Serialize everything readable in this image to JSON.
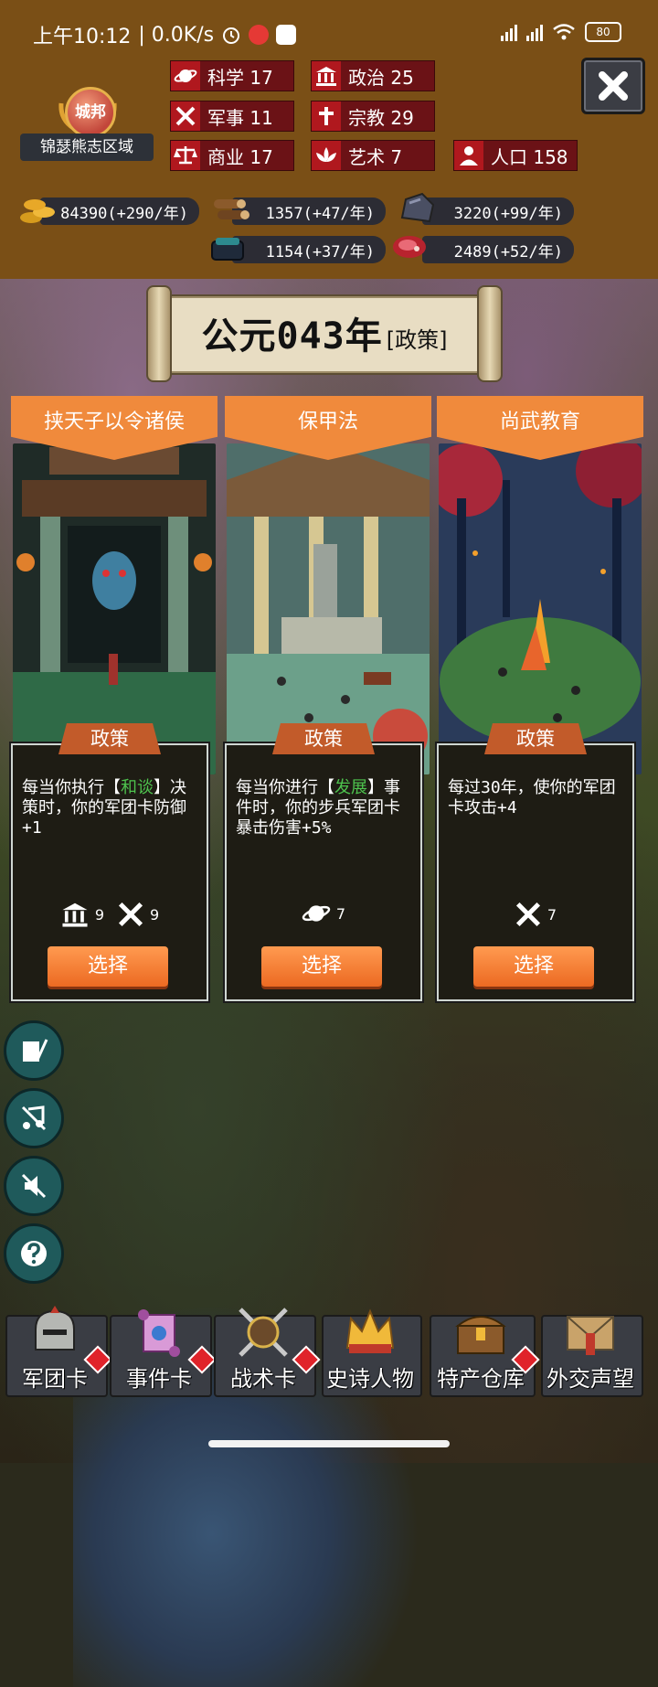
{
  "status_bar": {
    "time": "上午10:12",
    "speed": "| 0.0K/s",
    "battery": "80"
  },
  "region": {
    "emblem_text": "城邦",
    "name": "锦瑟熊志区域"
  },
  "stats": {
    "science": "科学 17",
    "politics": "政治 25",
    "military": "军事 11",
    "religion": "宗教 29",
    "commerce": "商业 17",
    "art": "艺术 7",
    "population": "人口 158"
  },
  "resources": {
    "gold": "84390(+290/年)",
    "wood": "1357(+47/年)",
    "ore": "3220(+99/年)",
    "cloth": "1154(+37/年)",
    "meat": "2489(+52/年)"
  },
  "title": {
    "main": "公元043年",
    "sub": "[政策]"
  },
  "cards": [
    {
      "name": "挟天子以令诸侯",
      "tag": "政策",
      "desc_a": "每当你执行【",
      "desc_hl": "和谈",
      "desc_b": "】决策时，你的军团卡防御+1",
      "req1": "9",
      "req2": "9",
      "button": "选择"
    },
    {
      "name": "保甲法",
      "tag": "政策",
      "desc_a": "每当你进行【",
      "desc_hl": "发展",
      "desc_b": "】事件时，你的步兵军团卡暴击伤害+5%",
      "req1": "7",
      "button": "选择"
    },
    {
      "name": "尚武教育",
      "tag": "政策",
      "desc_a": "每过30年，使你的军团卡攻击+4",
      "req1": "7",
      "button": "选择"
    }
  ],
  "bottom_nav": [
    {
      "label": "军团卡"
    },
    {
      "label": "事件卡"
    },
    {
      "label": "战术卡"
    },
    {
      "label": "史诗人物"
    },
    {
      "label": "特产仓库"
    },
    {
      "label": "外交声望"
    }
  ],
  "colors": {
    "header_bg": "#7a4f16",
    "stat_bg": "#6b1216",
    "banner": "#f08a3c",
    "button": "#ec6a22",
    "highlight_text": "#4ec34e"
  }
}
